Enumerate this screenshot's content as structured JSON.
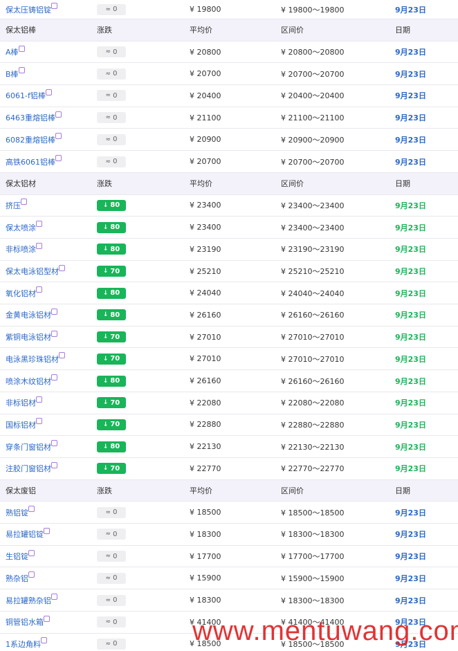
{
  "headers": {
    "change": "涨跌",
    "avg": "平均价",
    "range": "区间价",
    "date": "日期"
  },
  "colors": {
    "link": "#2c68c8",
    "down": "#18b559",
    "flat": "#efeff2",
    "section": "#f3f2fa"
  },
  "icons": {
    "flat": "flat-trend-icon",
    "down": "down-arrow-icon"
  },
  "rows": [
    {
      "type": "item",
      "name": "保太压铸铝锭",
      "change": "0",
      "dir": "flat",
      "avg": "¥ 19800",
      "range": "¥ 19800～19800",
      "date": "9月23日"
    },
    {
      "type": "section",
      "name": "保太铝棒"
    },
    {
      "type": "item",
      "name": "A棒",
      "change": "0",
      "dir": "flat",
      "avg": "¥ 20800",
      "range": "¥ 20800～20800",
      "date": "9月23日"
    },
    {
      "type": "item",
      "name": "B棒",
      "change": "0",
      "dir": "flat",
      "avg": "¥ 20700",
      "range": "¥ 20700～20700",
      "date": "9月23日"
    },
    {
      "type": "item",
      "name": "6061-f铝棒",
      "change": "0",
      "dir": "flat",
      "avg": "¥ 20400",
      "range": "¥ 20400～20400",
      "date": "9月23日"
    },
    {
      "type": "item",
      "name": "6463重熔铝棒",
      "change": "0",
      "dir": "flat",
      "avg": "¥ 21100",
      "range": "¥ 21100～21100",
      "date": "9月23日"
    },
    {
      "type": "item",
      "name": "6082重熔铝棒",
      "change": "0",
      "dir": "flat",
      "avg": "¥ 20900",
      "range": "¥ 20900～20900",
      "date": "9月23日"
    },
    {
      "type": "item",
      "name": "高铁6061铝棒",
      "change": "0",
      "dir": "flat",
      "avg": "¥ 20700",
      "range": "¥ 20700～20700",
      "date": "9月23日"
    },
    {
      "type": "section",
      "name": "保太铝材"
    },
    {
      "type": "item",
      "name": "挤压",
      "change": "80",
      "dir": "down",
      "avg": "¥ 23400",
      "range": "¥ 23400～23400",
      "date": "9月23日"
    },
    {
      "type": "item",
      "name": "保太喷涂",
      "change": "80",
      "dir": "down",
      "avg": "¥ 23400",
      "range": "¥ 23400～23400",
      "date": "9月23日"
    },
    {
      "type": "item",
      "name": "非标喷涂",
      "change": "80",
      "dir": "down",
      "avg": "¥ 23190",
      "range": "¥ 23190～23190",
      "date": "9月23日"
    },
    {
      "type": "item",
      "name": "保太电泳铝型材",
      "change": "70",
      "dir": "down",
      "avg": "¥ 25210",
      "range": "¥ 25210～25210",
      "date": "9月23日"
    },
    {
      "type": "item",
      "name": "氧化铝材",
      "change": "80",
      "dir": "down",
      "avg": "¥ 24040",
      "range": "¥ 24040～24040",
      "date": "9月23日"
    },
    {
      "type": "item",
      "name": "金黄电泳铝材",
      "change": "80",
      "dir": "down",
      "avg": "¥ 26160",
      "range": "¥ 26160～26160",
      "date": "9月23日"
    },
    {
      "type": "item",
      "name": "紫铜电泳铝材",
      "change": "70",
      "dir": "down",
      "avg": "¥ 27010",
      "range": "¥ 27010～27010",
      "date": "9月23日"
    },
    {
      "type": "item",
      "name": "电泳黑珍珠铝材",
      "change": "70",
      "dir": "down",
      "avg": "¥ 27010",
      "range": "¥ 27010～27010",
      "date": "9月23日"
    },
    {
      "type": "item",
      "name": "喷涂木纹铝材",
      "change": "80",
      "dir": "down",
      "avg": "¥ 26160",
      "range": "¥ 26160～26160",
      "date": "9月23日"
    },
    {
      "type": "item",
      "name": "非标铝材",
      "change": "70",
      "dir": "down",
      "avg": "¥ 22080",
      "range": "¥ 22080～22080",
      "date": "9月23日"
    },
    {
      "type": "item",
      "name": "国标铝材",
      "change": "70",
      "dir": "down",
      "avg": "¥ 22880",
      "range": "¥ 22880～22880",
      "date": "9月23日"
    },
    {
      "type": "item",
      "name": "穿条门窗铝材",
      "change": "80",
      "dir": "down",
      "avg": "¥ 22130",
      "range": "¥ 22130～22130",
      "date": "9月23日"
    },
    {
      "type": "item",
      "name": "注胶门窗铝材",
      "change": "70",
      "dir": "down",
      "avg": "¥ 22770",
      "range": "¥ 22770～22770",
      "date": "9月23日"
    },
    {
      "type": "section",
      "name": "保太废铝"
    },
    {
      "type": "item",
      "name": "熟铝锭",
      "change": "0",
      "dir": "flat",
      "avg": "¥ 18500",
      "range": "¥ 18500～18500",
      "date": "9月23日"
    },
    {
      "type": "item",
      "name": "易拉罐铝锭",
      "change": "0",
      "dir": "flat",
      "avg": "¥ 18300",
      "range": "¥ 18300～18300",
      "date": "9月23日"
    },
    {
      "type": "item",
      "name": "生铝锭",
      "change": "0",
      "dir": "flat",
      "avg": "¥ 17700",
      "range": "¥ 17700～17700",
      "date": "9月23日"
    },
    {
      "type": "item",
      "name": "熟杂铝",
      "change": "0",
      "dir": "flat",
      "avg": "¥ 15900",
      "range": "¥ 15900～15900",
      "date": "9月23日"
    },
    {
      "type": "item",
      "name": "易拉罐熟杂铝",
      "change": "0",
      "dir": "flat",
      "avg": "¥ 18300",
      "range": "¥ 18300～18300",
      "date": "9月23日"
    },
    {
      "type": "item",
      "name": "铜管铝水箱",
      "change": "0",
      "dir": "flat",
      "avg": "¥ 41400",
      "range": "¥ 41400～41400",
      "date": "9月23日"
    },
    {
      "type": "item",
      "name": "1系边角料",
      "change": "0",
      "dir": "flat",
      "avg": "¥ 18500",
      "range": "¥ 18500～18500",
      "date": "9月23日"
    }
  ],
  "watermark": "www.mentuwang.com"
}
